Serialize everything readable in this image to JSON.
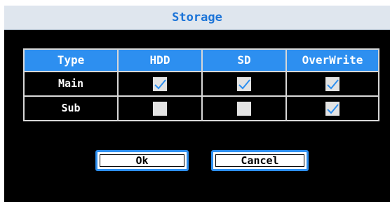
{
  "dialog": {
    "title": "Storage"
  },
  "table": {
    "headers": [
      "Type",
      "HDD",
      "SD",
      "OverWrite"
    ],
    "rows": [
      {
        "label": "Main",
        "hdd": true,
        "sd": true,
        "overwrite": true
      },
      {
        "label": "Sub",
        "hdd": false,
        "sd": false,
        "overwrite": true
      }
    ]
  },
  "buttons": {
    "ok_label": "Ok",
    "cancel_label": "Cancel"
  },
  "colors": {
    "accent": "#2d8ff0",
    "title_text": "#1a73d8",
    "dialog_bg": "#000000",
    "checkbox_bg": "#e3e3e3"
  }
}
